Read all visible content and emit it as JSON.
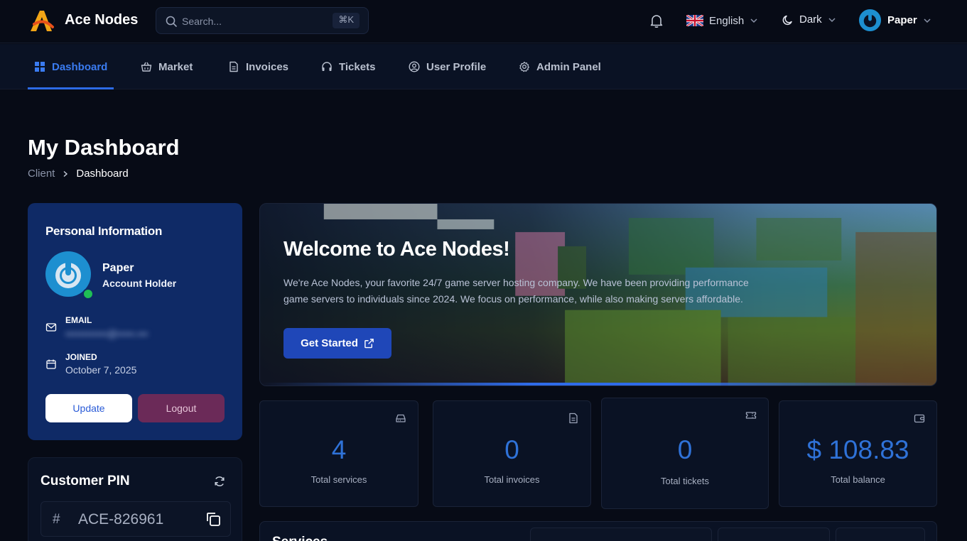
{
  "brand": {
    "name": "Ace Nodes"
  },
  "search": {
    "placeholder": "Search...",
    "shortcut": "⌘K"
  },
  "topbar": {
    "language": "English",
    "theme": "Dark",
    "user": "Paper"
  },
  "nav": [
    {
      "label": "Dashboard",
      "icon": "grid-icon",
      "active": true
    },
    {
      "label": "Market",
      "icon": "basket-icon"
    },
    {
      "label": "Invoices",
      "icon": "document-icon"
    },
    {
      "label": "Tickets",
      "icon": "headset-icon"
    },
    {
      "label": "User Profile",
      "icon": "user-circle-icon"
    },
    {
      "label": "Admin Panel",
      "icon": "gear-icon"
    }
  ],
  "page": {
    "title": "My Dashboard",
    "breadcrumb": [
      "Client",
      "Dashboard"
    ]
  },
  "personal": {
    "title": "Personal Information",
    "name": "Paper",
    "role": "Account Holder",
    "email_label": "EMAIL",
    "email_value": "••••••••••••@•••••.•••",
    "joined_label": "JOINED",
    "joined_value": "October 7, 2025",
    "update_label": "Update",
    "logout_label": "Logout"
  },
  "pin": {
    "title": "Customer PIN",
    "hash": "#",
    "value": "ACE-826961"
  },
  "banner": {
    "title": "Welcome to Ace Nodes!",
    "text": "We're Ace Nodes, your favorite 24/7 game server hosting company. We have been providing performance game servers to individuals since 2024. We focus on performance, while also making servers affordable.",
    "cta": "Get Started"
  },
  "stats": [
    {
      "value": "4",
      "label": "Total services",
      "icon": "server-icon"
    },
    {
      "value": "0",
      "label": "Total invoices",
      "icon": "document-icon"
    },
    {
      "value": "0",
      "label": "Total tickets",
      "icon": "ticket-icon"
    },
    {
      "value": "$ 108.83",
      "label": "Total balance",
      "icon": "wallet-icon"
    }
  ],
  "services": {
    "title": "Services"
  },
  "colors": {
    "accent": "#2d6be6",
    "card": "#0f2a66",
    "logout": "#6b2a58",
    "online": "#1fbf55",
    "stat_value": "#2f72d8"
  }
}
